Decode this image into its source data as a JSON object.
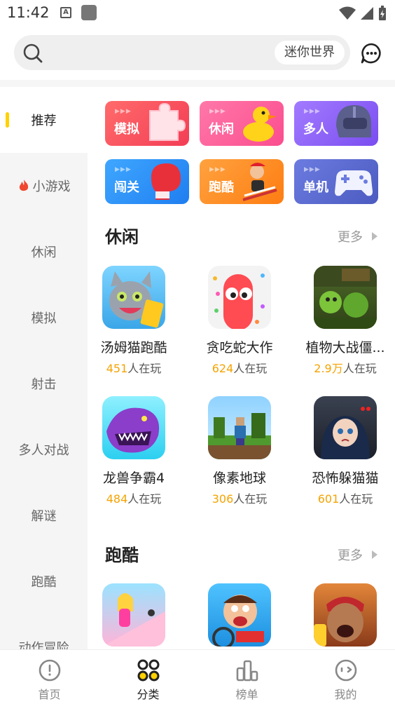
{
  "status": {
    "time": "11:42",
    "notif_letter": "A"
  },
  "search": {
    "hot_tag": "迷你世界"
  },
  "sidebar": {
    "items": [
      {
        "label": "推荐"
      },
      {
        "label": "小游戏",
        "icon": "fire-icon"
      },
      {
        "label": "休闲"
      },
      {
        "label": "模拟"
      },
      {
        "label": "射击"
      },
      {
        "label": "多人对战"
      },
      {
        "label": "解谜"
      },
      {
        "label": "跑酷"
      },
      {
        "label": "动作冒险"
      }
    ],
    "active_index": 0
  },
  "categories": [
    {
      "label": "模拟",
      "color": "#f7435b",
      "icon": "puzzle-icon"
    },
    {
      "label": "休闲",
      "color": "#fb4d8f",
      "icon": "duck-icon"
    },
    {
      "label": "多人",
      "color": "#8a59f2",
      "icon": "helmet-icon"
    },
    {
      "label": "闯关",
      "color": "#1f8cf0",
      "icon": "boxing-glove-icon"
    },
    {
      "label": "跑酷",
      "color": "#fe8a18",
      "icon": "runner-icon"
    },
    {
      "label": "单机",
      "color": "#5566c8",
      "icon": "gamepad-icon"
    }
  ],
  "sections": [
    {
      "title": "休闲",
      "more": "更多",
      "games": [
        {
          "name": "汤姆猫跑酷",
          "plays_num": "451",
          "plays_suffix": "人在玩"
        },
        {
          "name": "贪吃蛇大作",
          "plays_num": "624",
          "plays_suffix": "人在玩"
        },
        {
          "name": "植物大战僵...",
          "plays_num": "2.9万",
          "plays_suffix": "人在玩"
        },
        {
          "name": "龙兽争霸4",
          "plays_num": "484",
          "plays_suffix": "人在玩"
        },
        {
          "name": "像素地球",
          "plays_num": "306",
          "plays_suffix": "人在玩"
        },
        {
          "name": "恐怖躲猫猫",
          "plays_num": "601",
          "plays_suffix": "人在玩"
        }
      ]
    },
    {
      "title": "跑酷",
      "more": "更多",
      "games": []
    }
  ],
  "tabbar": {
    "items": [
      {
        "label": "首页"
      },
      {
        "label": "分类"
      },
      {
        "label": "榜单"
      },
      {
        "label": "我的"
      }
    ],
    "active_index": 1
  },
  "colors": {
    "accent": "#ffd100",
    "plays_number": "#f5a300"
  }
}
